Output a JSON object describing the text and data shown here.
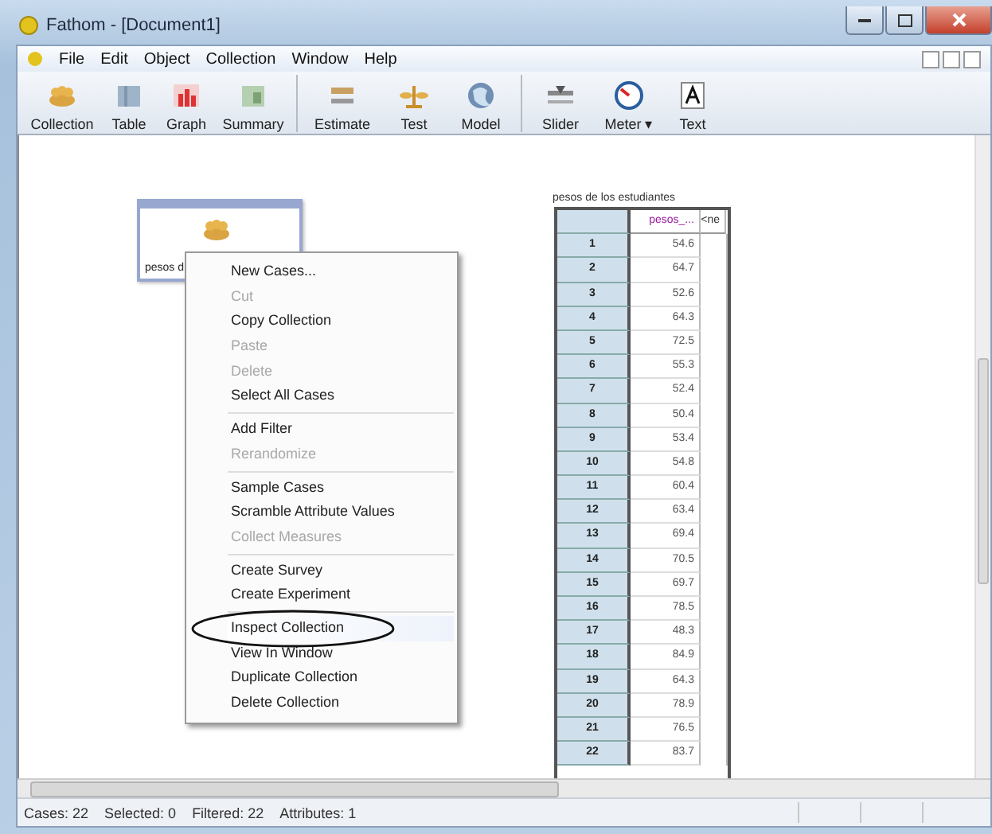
{
  "window": {
    "title": "Fathom - [Document1]"
  },
  "menu_bar": [
    "File",
    "Edit",
    "Object",
    "Collection",
    "Window",
    "Help"
  ],
  "toolbar": [
    {
      "label": "Collection"
    },
    {
      "label": "Table"
    },
    {
      "label": "Graph"
    },
    {
      "label": "Summary"
    },
    {
      "label": "Estimate"
    },
    {
      "label": "Test"
    },
    {
      "label": "Model"
    },
    {
      "label": "Slider"
    },
    {
      "label": "Meter ▾"
    },
    {
      "label": "Text"
    }
  ],
  "collection": {
    "name": "pesos d",
    "selected": true
  },
  "context_menu": {
    "groups": [
      [
        {
          "label": "New Cases...",
          "disabled": false,
          "selected": false
        },
        {
          "label": "Cut",
          "disabled": true,
          "selected": false
        },
        {
          "label": "Copy Collection",
          "disabled": false,
          "selected": false
        },
        {
          "label": "Paste",
          "disabled": true,
          "selected": false
        },
        {
          "label": "Delete",
          "disabled": true,
          "selected": false
        },
        {
          "label": "Select All Cases",
          "disabled": false,
          "selected": false
        }
      ],
      [
        {
          "label": "Add Filter",
          "disabled": false,
          "selected": false
        },
        {
          "label": "Rerandomize",
          "disabled": true,
          "selected": false
        }
      ],
      [
        {
          "label": "Sample Cases",
          "disabled": false,
          "selected": false
        },
        {
          "label": "Scramble Attribute Values",
          "disabled": false,
          "selected": false
        },
        {
          "label": "Collect Measures",
          "disabled": true,
          "selected": false
        }
      ],
      [
        {
          "label": "Create Survey",
          "disabled": false,
          "selected": false
        },
        {
          "label": "Create Experiment",
          "disabled": false,
          "selected": false
        }
      ],
      [
        {
          "label": "Inspect Collection",
          "disabled": false,
          "selected": true,
          "circled": true
        },
        {
          "label": "View In Window",
          "disabled": false,
          "selected": false
        },
        {
          "label": "Duplicate Collection",
          "disabled": false,
          "selected": false
        },
        {
          "label": "Delete Collection",
          "disabled": false,
          "selected": false
        }
      ]
    ]
  },
  "case_table": {
    "title": "pesos de los estudiantes",
    "columns": [
      "",
      "pesos_...",
      "<ne"
    ],
    "rows": [
      [
        "1",
        "54.6"
      ],
      [
        "2",
        "64.7"
      ],
      [
        "3",
        "52.6"
      ],
      [
        "4",
        "64.3"
      ],
      [
        "5",
        "72.5"
      ],
      [
        "6",
        "55.3"
      ],
      [
        "7",
        "52.4"
      ],
      [
        "8",
        "50.4"
      ],
      [
        "9",
        "53.4"
      ],
      [
        "10",
        "54.8"
      ],
      [
        "11",
        "60.4"
      ],
      [
        "12",
        "63.4"
      ],
      [
        "13",
        "69.4"
      ],
      [
        "14",
        "70.5"
      ],
      [
        "15",
        "69.7"
      ],
      [
        "16",
        "78.5"
      ],
      [
        "17",
        "48.3"
      ],
      [
        "18",
        "84.9"
      ],
      [
        "19",
        "64.3"
      ],
      [
        "20",
        "78.9"
      ],
      [
        "21",
        "76.5"
      ],
      [
        "22",
        "83.7"
      ]
    ]
  },
  "status_bar": [
    "Cases: 22",
    "Selected: 0",
    "Filtered: 22",
    "Attributes: 1"
  ]
}
